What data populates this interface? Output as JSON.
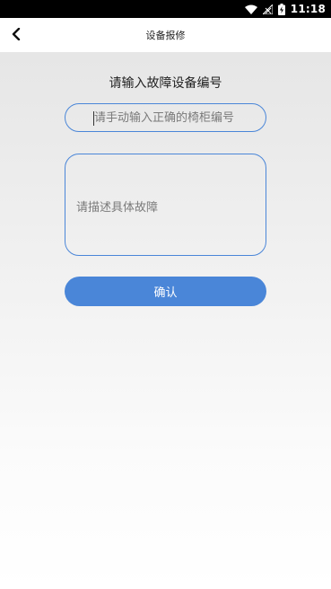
{
  "status_bar": {
    "time": "11:18",
    "icons": [
      "wifi-icon",
      "signal-off-icon",
      "battery-charging-icon"
    ],
    "background": "#000000"
  },
  "nav": {
    "back_icon": "chevron-left-icon",
    "title": "设备报修"
  },
  "form": {
    "title": "请输入故障设备编号",
    "code_placeholder": "请手动输入正确的椅柜编号",
    "code_value": "",
    "description_placeholder": "请描述具体故障",
    "description_value": "",
    "confirm_label": "确认"
  },
  "colors": {
    "accent": "#4a86d8",
    "nav_background": "#ffffff",
    "content_top": "#e6e6e6",
    "content_bottom": "#ffffff"
  }
}
